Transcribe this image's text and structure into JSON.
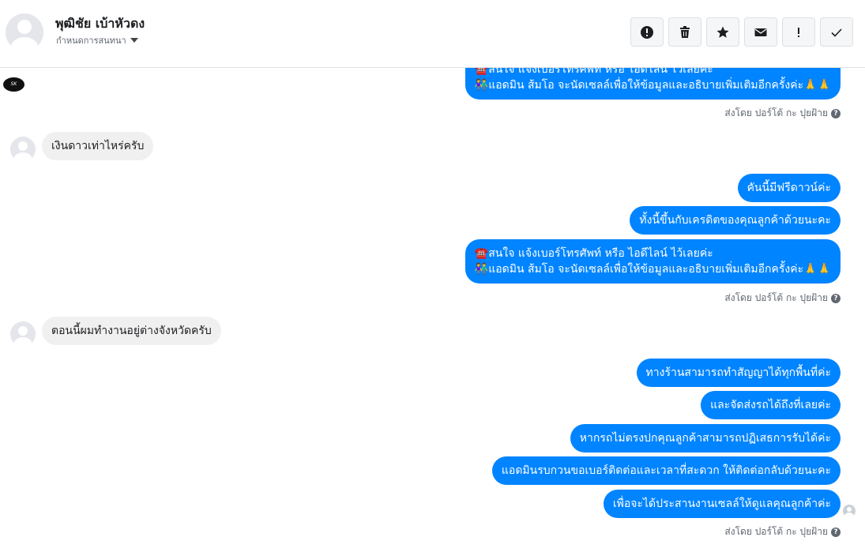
{
  "header": {
    "contact_name": "พุฒิชัย เบ้าหัวดง",
    "assign_label": "กำหนดการสนทนา",
    "actions": [
      "spam-icon",
      "trash-icon",
      "star-icon",
      "envelope-icon",
      "exclamation-icon",
      "check-icon"
    ]
  },
  "logo_text": "SK",
  "messages": {
    "m0_line1": "☎️สนใจ แจ้งเบอร์โทรศัพท์ หรือ ไอดีไลน์  ไว้เลยค่ะ",
    "m0_line2": "👫แอดมิน ส้มโอ จะนัดเซลล์เพื่อให้ข้อมูลและอธิบายเพิ่มเติมอีกครั้งค่ะ🙏🙏",
    "sent_by_1": "ส่งโดย ปอร์โต้ กะ ปุยฝ้าย",
    "in_1": "เงินดาวเท่าไหร่ครับ",
    "out_1": "คันนี้มีฟรีดาวน์ค่ะ",
    "out_2": "ทั้งนี้ขึ้นกับเครดิตของคุณลูกค้าด้วยนะคะ",
    "out_3_line1": "☎️สนใจ แจ้งเบอร์โทรศัพท์ หรือ ไอดีไลน์  ไว้เลยค่ะ",
    "out_3_line2": "👫แอดมิน ส้มโอ จะนัดเซลล์เพื่อให้ข้อมูลและอธิบายเพิ่มเติมอีกครั้งค่ะ🙏🙏",
    "sent_by_2": "ส่งโดย ปอร์โต้ กะ ปุยฝ้าย",
    "in_2": "ตอนนี้ผมทำงานอยู่ต่างจังหวัดครับ",
    "out_4": "ทางร้านสามารถทำสัญญาได้ทุกพื้นที่ค่ะ",
    "out_5": "และจัดส่งรถได้ถึงที่เลยค่ะ",
    "out_6": "หากรถไม่ตรงปกคุณลูกค้าสามารถปฏิเสธการรับได้ค่ะ",
    "out_7": "แอดมินรบกวนขอเบอร์ติดต่อและเวลาที่สะดวก ให้ติดต่อกลับด้วยนะคะ",
    "out_8": "เพื่อจะได้ประสานงานเซลล์ให้ดูแลคุณลูกค้าค่ะ",
    "sent_by_3": "ส่งโดย ปอร์โต้ กะ ปุยฝ้าย"
  },
  "colors": {
    "bubble_out": "#0084ff",
    "bubble_in": "#f1f0f0",
    "divider": "#dddfe2"
  }
}
